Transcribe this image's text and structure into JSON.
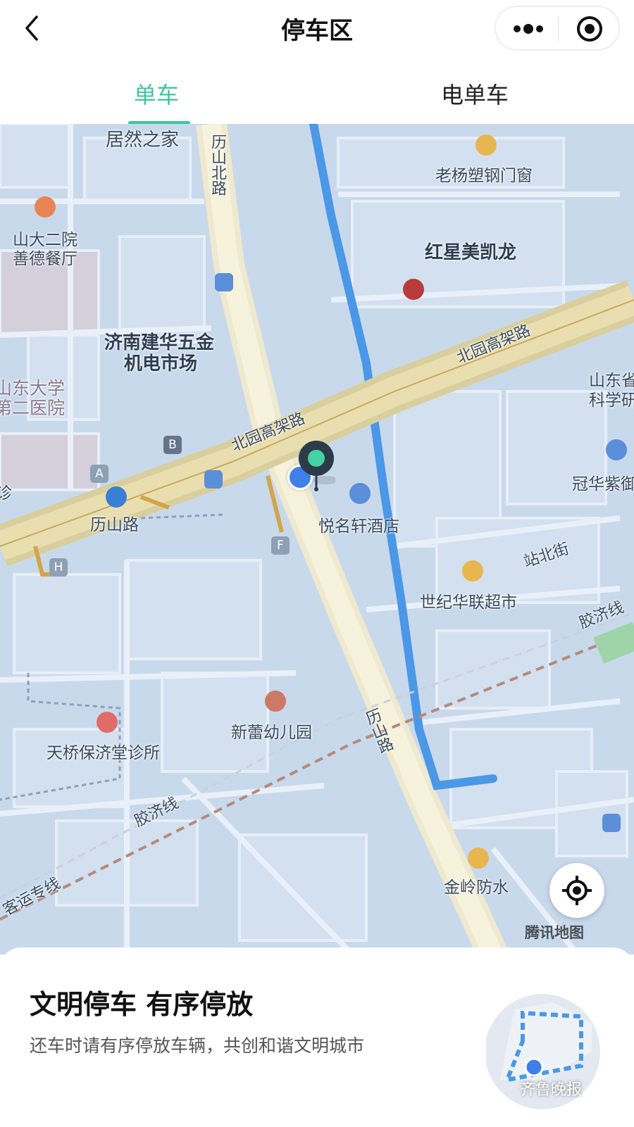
{
  "header": {
    "title": "停车区",
    "more_icon": "more-dots-icon",
    "close_icon": "target-close-icon"
  },
  "tabs": [
    {
      "label": "单车",
      "active": true
    },
    {
      "label": "电单车",
      "active": false
    }
  ],
  "map": {
    "labels": {
      "jurenzhijia": "居然之家",
      "lishanbeilu": "历山北路",
      "laoyang": "老杨塑钢门窗",
      "shanda_1": "山大二院",
      "shanda_2": "善德餐厅",
      "hongxing": "红星美凯龙",
      "jinan_1": "济南建华五金",
      "jinan_2": "机电市场",
      "beiyuan_1": "北园高架路",
      "beiyuan_2": "北园高架路",
      "sdu_1": "山东大学",
      "sdu_2": "第二医院",
      "shandongsheng_1": "山东省",
      "shandongsheng_2": "科学研",
      "guanhua": "冠华紫御",
      "lishanlu": "历山路",
      "yuemingxuan": "悦名轩酒店",
      "zhanbeijie": "站北街",
      "shiji": "世纪华联超市",
      "jiaoji_1": "胶济线",
      "xinlei": "新蕾幼儿园",
      "tianqiao": "天桥保济堂诊所",
      "lishan_road": "历山路",
      "jiaoji_2": "胶济线",
      "keyun": "客运专线",
      "jinling": "金岭防水",
      "zhen": "诊"
    },
    "station_letters": [
      "A",
      "B",
      "F",
      "H"
    ],
    "attribution": "腾讯地图"
  },
  "sheet": {
    "title": "文明停车 有序停放",
    "subtitle": "还车时请有序停放车辆，共创和谐文明城市"
  },
  "watermark": "齐鲁晚报",
  "colors": {
    "accent": "#3fc6a0",
    "map_bg": "#c9d9ec",
    "highway": "#e8dcae",
    "river": "#4a98e6"
  }
}
